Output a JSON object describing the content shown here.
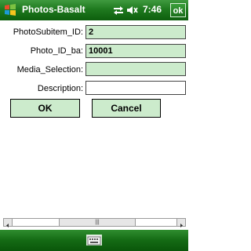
{
  "title_bar": {
    "app_title": "Photos-Basalt",
    "time": "7:46",
    "ok_label": "ok"
  },
  "form": {
    "fields": [
      {
        "label": "PhotoSubitem_ID:",
        "value": "2"
      },
      {
        "label": "Photo_ID_ba:",
        "value": "10001"
      },
      {
        "label": "Media_Selection:",
        "value": ""
      },
      {
        "label": "Description:",
        "value": ""
      }
    ],
    "ok_button": "OK",
    "cancel_button": "Cancel"
  },
  "scrollbar": {
    "thumb_glyph": "|||"
  },
  "icons": {
    "start": "windows-flag-icon",
    "network": "network-icon",
    "volume": "volume-icon",
    "keyboard": "keyboard-icon"
  },
  "colors": {
    "titlebar_green": "#1f7a1f",
    "field_green": "#ccebcc"
  }
}
